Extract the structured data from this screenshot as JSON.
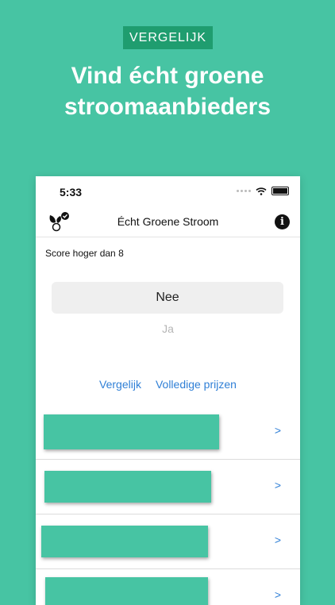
{
  "promo": {
    "badge": "VERGELIJK",
    "headline_line1": "Vind écht groene",
    "headline_line2": "stroomaanbieders"
  },
  "status_bar": {
    "time": "5:33"
  },
  "nav": {
    "title": "Écht Groene Stroom"
  },
  "filter": {
    "score_label": "Score hoger dan 8",
    "picker_selected": "Nee",
    "picker_option": "Ja"
  },
  "links": {
    "compare": "Vergelijk",
    "full_prices": "Volledige prijzen"
  },
  "providers": [
    {
      "chevron": ">"
    },
    {
      "chevron": ">"
    },
    {
      "chevron": ">"
    },
    {
      "chevron": ">"
    }
  ],
  "colors": {
    "background": "#47c4a3",
    "badge": "#1f9d6f",
    "link": "#2f7fd6"
  }
}
